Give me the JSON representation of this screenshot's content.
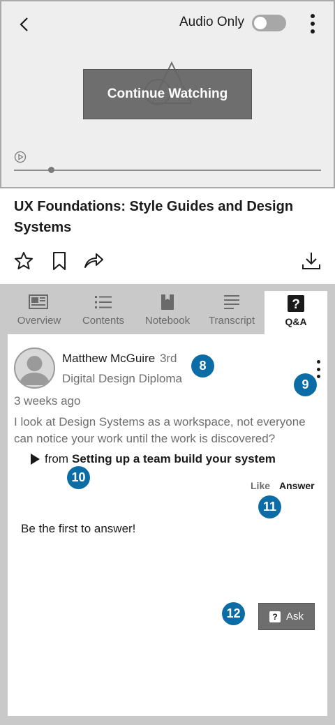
{
  "player": {
    "audio_only_label": "Audio Only",
    "audio_only_on": false,
    "continue_label": "Continue Watching",
    "progress_fraction": 0.12
  },
  "course": {
    "title": "UX Foundations: Style Guides and Design Systems"
  },
  "actions": {
    "icons": [
      "star-icon",
      "bookmark-icon",
      "share-icon",
      "download-icon"
    ]
  },
  "tabs": [
    {
      "label": "Overview",
      "icon": "newspaper-icon",
      "active": false
    },
    {
      "label": "Contents",
      "icon": "list-icon",
      "active": false
    },
    {
      "label": "Notebook",
      "icon": "notebook-icon",
      "active": false
    },
    {
      "label": "Transcript",
      "icon": "transcript-icon",
      "active": false
    },
    {
      "label": "Q&A",
      "icon": "question-icon",
      "active": true
    }
  ],
  "post": {
    "author": "Matthew McGuire",
    "degree": "3rd",
    "subtitle": "Digital Design Diploma",
    "time": "3 weeks ago",
    "body": "I look at Design Systems as a workspace, not everyone can notice your work until the work is discovered?",
    "source_prefix": "from",
    "source_title": "Setting up a team build your system",
    "like_label": "Like",
    "answer_label": "Answer",
    "empty_message": "Be the first to answer!"
  },
  "ask_button": {
    "label": "Ask"
  },
  "badges": {
    "b8": "8",
    "b9": "9",
    "b10": "10",
    "b11": "11",
    "b12": "12"
  },
  "colors": {
    "badge": "#0b6ca6",
    "panel_gray": "#c9c9c9",
    "button_gray": "#6e6e6e"
  }
}
